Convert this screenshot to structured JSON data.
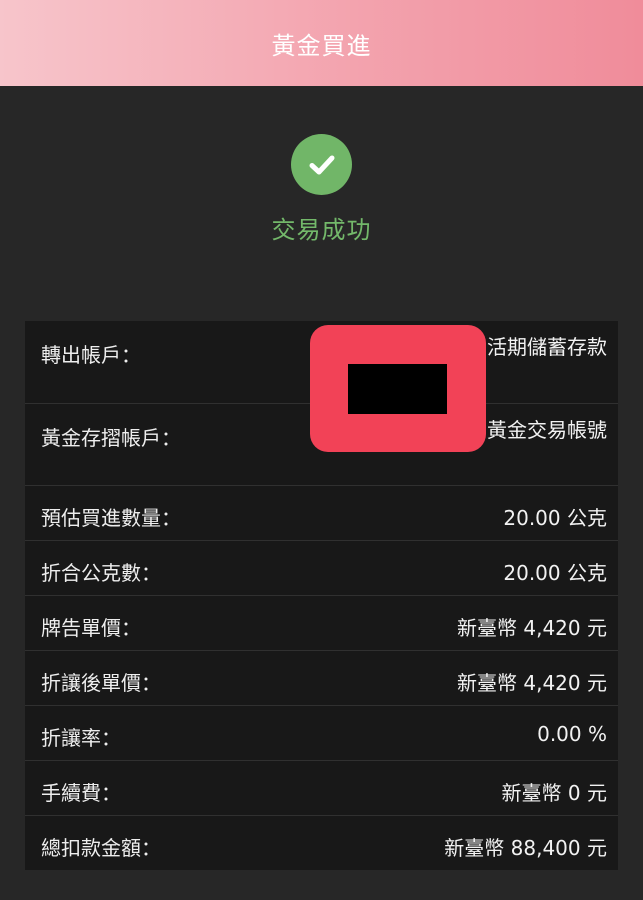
{
  "header": {
    "title": "黃金買進"
  },
  "status": {
    "icon": "check-circle-icon",
    "text": "交易成功",
    "color": "#71b668"
  },
  "details": {
    "rows": [
      {
        "label": "轉出帳戶：",
        "value": "活期儲蓄存款"
      },
      {
        "label": "黃金存摺帳戶：",
        "value": "黃金交易帳號"
      },
      {
        "label": "預估買進數量：",
        "value": "20.00 公克"
      },
      {
        "label": "折合公克數：",
        "value": "20.00 公克"
      },
      {
        "label": "牌告單價：",
        "value": "新臺幣 4,420 元"
      },
      {
        "label": "折讓後單價：",
        "value": "新臺幣 4,420 元"
      },
      {
        "label": "折讓率：",
        "value": "0.00 %"
      },
      {
        "label": "手續費：",
        "value": "新臺幣 0 元"
      },
      {
        "label": "總扣款金額：",
        "value": "新臺幣 88,400 元"
      }
    ]
  }
}
